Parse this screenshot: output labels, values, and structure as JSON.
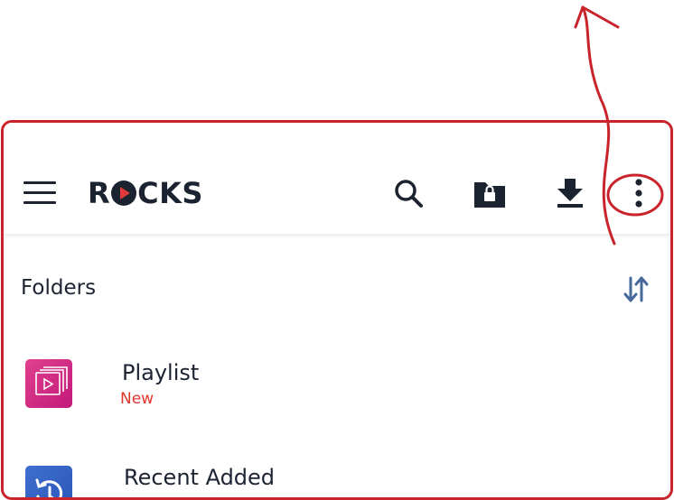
{
  "app": {
    "logo_text_left": "R",
    "logo_text_right": "CKS"
  },
  "toolbar": {
    "menu_icon": "hamburger-menu-icon",
    "search_icon": "search-icon",
    "private_folder_icon": "locked-folder-icon",
    "download_icon": "download-icon",
    "more_icon": "more-vertical-icon"
  },
  "section": {
    "title": "Folders",
    "sort_icon": "sort-arrows-icon"
  },
  "items": [
    {
      "title": "Playlist",
      "badge": "New",
      "icon": "playlist-icon"
    },
    {
      "title": "Recent Added",
      "badge": "",
      "icon": "history-icon"
    }
  ],
  "colors": {
    "accent_red": "#c9242b",
    "badge_red": "#e0352b",
    "playlist_thumb": "#d02b85",
    "recent_thumb": "#3562c2",
    "dark": "#1b2230"
  }
}
